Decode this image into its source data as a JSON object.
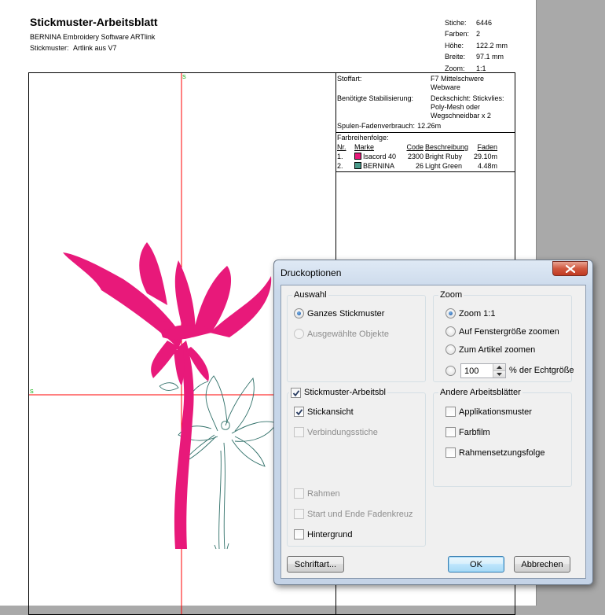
{
  "sheet": {
    "title": "Stickmuster-Arbeitsblatt",
    "software": "BERNINA Embroidery Software ARTlink",
    "design_label": "Stickmuster:",
    "design_value": "Artlink aus V7",
    "stats": [
      {
        "label": "Stiche:",
        "value": "6446"
      },
      {
        "label": "Farben:",
        "value": "2"
      },
      {
        "label": "Höhe:",
        "value": "122.2 mm"
      },
      {
        "label": "Breite:",
        "value": "97.1 mm"
      },
      {
        "label": "Zoom:",
        "value": "1:1"
      }
    ],
    "marker_label": "S",
    "info": {
      "fabric_label": "Stoffart:",
      "fabric_value": "F7 Mittelschwere Webware",
      "stabilizer_label": "Benötigte Stabilisierung:",
      "stabilizer_value": "Deckschicht: Stickvlies: Poly-Mesh oder Wegschneidbar x 2",
      "bobbin_label": "Spulen-Fadenverbrauch:",
      "bobbin_value": "12.26m",
      "sequence_label": "Farbreihenfolge:",
      "columns": {
        "nr": "Nr.",
        "brand": "Marke",
        "code": "Code",
        "desc": "Beschreibung",
        "thread": "Faden"
      },
      "colors": [
        {
          "nr": "1.",
          "brand": "Isacord 40",
          "code": "2300",
          "desc": "Bright Ruby",
          "thread": "29.10m",
          "swatch": "#e8197a"
        },
        {
          "nr": "2.",
          "brand": "BERNINA",
          "code": "26",
          "desc": "Light Green",
          "thread": "4.48m",
          "swatch": "#4a9a8a"
        }
      ]
    },
    "colors": {
      "flower": "#e8197a",
      "outline": "#2f6f68",
      "guide": "#ff0000",
      "marker": "#00aa00"
    }
  },
  "dialog": {
    "title": "Druckoptionen",
    "auswahl": {
      "title": "Auswahl",
      "whole": "Ganzes Stickmuster",
      "selected": "Ausgewählte Objekte"
    },
    "zoom": {
      "title": "Zoom",
      "zoom11": "Zoom 1:1",
      "fit_window": "Auf Fenstergröße zoomen",
      "fit_article": "Zum Artikel zoomen",
      "percent_value": "100",
      "percent_label": "% der Echtgröße"
    },
    "worksheet": {
      "title": "Stickmuster-Arbeitsbl",
      "stickansicht": "Stickansicht",
      "verbindung": "Verbindungsstiche",
      "rahmen": "Rahmen",
      "fadenkreuz": "Start und Ende Fadenkreuz",
      "hintergrund": "Hintergrund"
    },
    "andere": {
      "title": "Andere Arbeitsblätter",
      "applikation": "Applikationsmuster",
      "farbfilm": "Farbfilm",
      "rahmenfolge": "Rahmensetzungsfolge"
    },
    "buttons": {
      "font": "Schriftart...",
      "ok": "OK",
      "cancel": "Abbrechen"
    }
  }
}
